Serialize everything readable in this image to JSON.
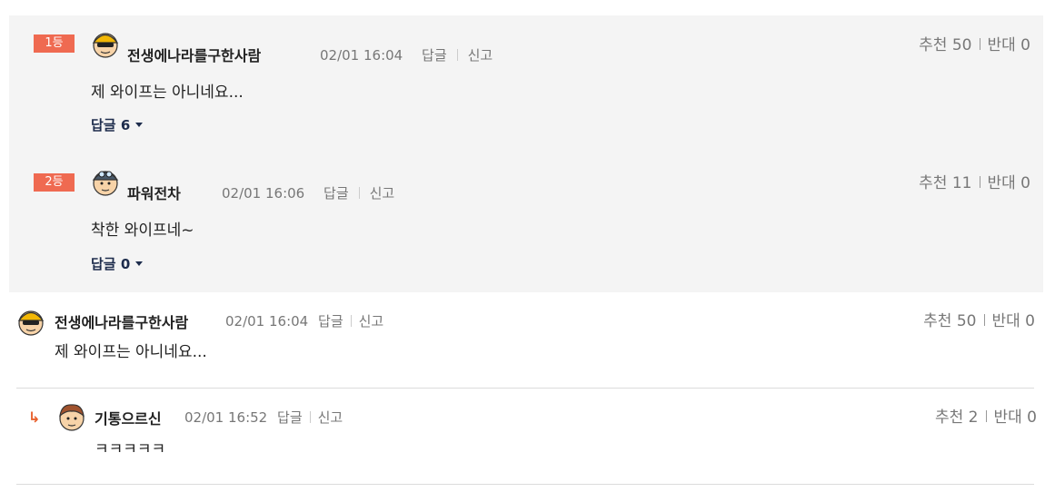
{
  "best_comments": [
    {
      "rank": "1등",
      "nickname": "전생에나라를구한사람",
      "time": "02/01 16:04",
      "reply_label": "답글",
      "report_label": "신고",
      "content": "제 와이프는 아니네요...",
      "replies_toggle": "답글 6",
      "recommend": "추천 50",
      "oppose": "반대 0"
    },
    {
      "rank": "2등",
      "nickname": "파워전차",
      "time": "02/01 16:06",
      "reply_label": "답글",
      "report_label": "신고",
      "content": "착한 와이프네~",
      "replies_toggle": "답글 0",
      "recommend": "추천 11",
      "oppose": "반대 0"
    }
  ],
  "comments": [
    {
      "nickname": "전생에나라를구한사람",
      "time": "02/01 16:04",
      "reply_label": "답글",
      "report_label": "신고",
      "content": "제 와이프는 아니네요...",
      "recommend": "추천 50",
      "oppose": "반대 0"
    }
  ],
  "replies": [
    {
      "arrow": "↳",
      "nickname": "기통으르신",
      "time": "02/01 16:52",
      "reply_label": "답글",
      "report_label": "신고",
      "content": "ㅋㅋㅋㅋㅋ",
      "recommend": "추천 2",
      "oppose": "반대 0"
    }
  ],
  "colors": {
    "rank_badge": "#ef6a51",
    "best_background": "#f4f4f4",
    "reply_arrow": "#e8602c",
    "reply_toggle": "#1d2c4c"
  },
  "icons": {
    "avatar_1": "yellow-helmet-avatar-icon",
    "avatar_2": "goggle-soldier-avatar-icon",
    "avatar_3": "yellow-helmet-avatar-icon",
    "avatar_4": "brown-hair-avatar-icon",
    "caret": "caret-down-icon"
  }
}
